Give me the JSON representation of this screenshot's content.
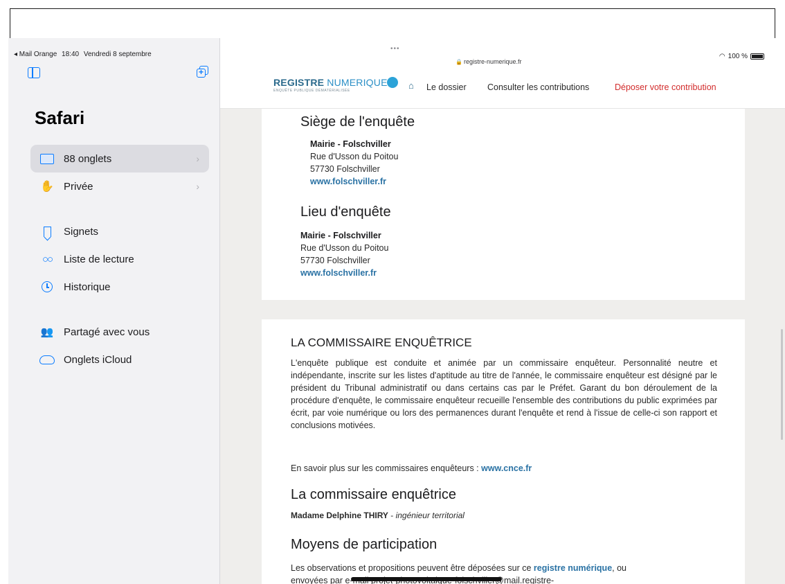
{
  "status_bar": {
    "carrier_back": "◂ Mail Orange",
    "time": "18:40",
    "date": "Vendredi 8 septembre",
    "wifi": "📶",
    "battery_text": "100 %"
  },
  "sidebar": {
    "title": "Safari",
    "items": [
      {
        "label": "88 onglets",
        "icon": "tabs-icon"
      },
      {
        "label": "Privée",
        "icon": "hand-icon"
      },
      {
        "label": "Signets",
        "icon": "bookmark-icon"
      },
      {
        "label": "Liste de lecture",
        "icon": "glasses-icon"
      },
      {
        "label": "Historique",
        "icon": "clock-icon"
      },
      {
        "label": "Partagé avec vous",
        "icon": "shared-people-icon"
      },
      {
        "label": "Onglets iCloud",
        "icon": "cloud-icon"
      }
    ]
  },
  "browser": {
    "dots": "•••",
    "url": "registre-numerique.fr"
  },
  "site": {
    "logo_primary": "REGISTRE",
    "logo_secondary": "NUMERIQUE",
    "logo_tagline": "ENQUÊTE PUBLIQUE DÉMATÉRIALISÉE",
    "nav": {
      "dossier": "Le dossier",
      "consulter": "Consulter les contributions",
      "deposer": "Déposer votre contribution"
    }
  },
  "siege": {
    "title": "Siège de l'enquête",
    "name": "Mairie - Folschviller",
    "street": "Rue d'Usson du Poitou",
    "city": "57730 Folschviller",
    "web": "www.folschviller.fr"
  },
  "lieu": {
    "title": "Lieu d'enquête",
    "name": "Mairie - Folschviller",
    "street": "Rue d'Usson du Poitou",
    "city": "57730 Folschviller",
    "web": "www.folschviller.fr"
  },
  "commissaire": {
    "title": "LA COMMISSAIRE ENQUÊTRICE",
    "paragraph": "L'enquête publique est conduite et animée par un commissaire enquêteur. Personnalité neutre et indépendante, inscrite sur les listes d'aptitude au titre de l'année, le commissaire enquêteur est désigné par le président du Tribunal administratif ou dans certains cas par le Préfet. Garant du bon déroulement de la procédure d'enquête, le commissaire enquêteur recueille l'ensemble des contributions du public exprimées par écrit, par voie numérique ou lors des permanences durant l'enquête et rend à l'issue de celle-ci son rapport et conclusions motivées.",
    "more_prefix": "En savoir plus sur les commissaires enquêteurs : ",
    "more_link": "www.cnce.fr",
    "sub_title": "La commissaire enquêtrice",
    "person_name": "Madame Delphine THIRY",
    "person_sep": " - ",
    "person_role": "ingénieur territorial",
    "moyens_title": "Moyens de participation",
    "moyens_prefix": "Les observations et propositions peuvent être déposées sur ce ",
    "moyens_link": "registre numérique",
    "moyens_suffix": ", ou",
    "moyens_line2": "envoyées par e-mail projet-photovoltaique-folschviller@mail.registre-"
  }
}
